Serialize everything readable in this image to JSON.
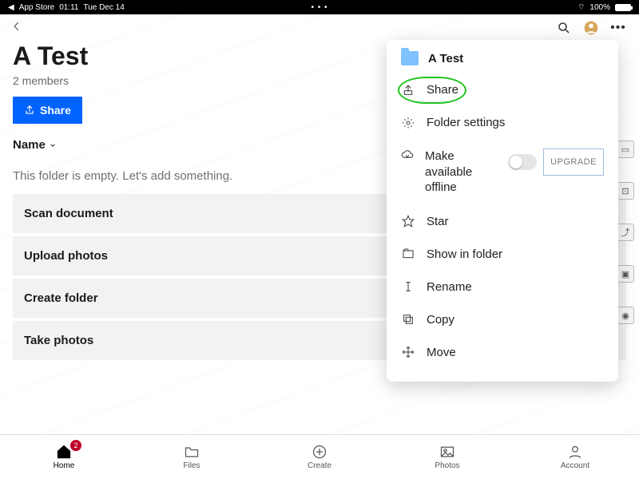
{
  "status": {
    "backTo": "App Store",
    "time": "01:11",
    "date": "Tue Dec 14",
    "battery": "100%"
  },
  "page": {
    "title": "A Test",
    "subtitle": "2 members",
    "shareLabel": "Share",
    "sortLabel": "Name",
    "emptyMsg": "This folder is empty. Let's add something."
  },
  "actions": [
    "Scan document",
    "Upload photos",
    "Create folder",
    "Take photos"
  ],
  "menu": {
    "title": "A Test",
    "items": {
      "share": "Share",
      "settings": "Folder settings",
      "offline": "Make available offline",
      "upgrade": "UPGRADE",
      "star": "Star",
      "show": "Show in folder",
      "rename": "Rename",
      "copy": "Copy",
      "move": "Move"
    }
  },
  "tabs": {
    "home": "Home",
    "files": "Files",
    "create": "Create",
    "photos": "Photos",
    "account": "Account",
    "badge": "2"
  }
}
